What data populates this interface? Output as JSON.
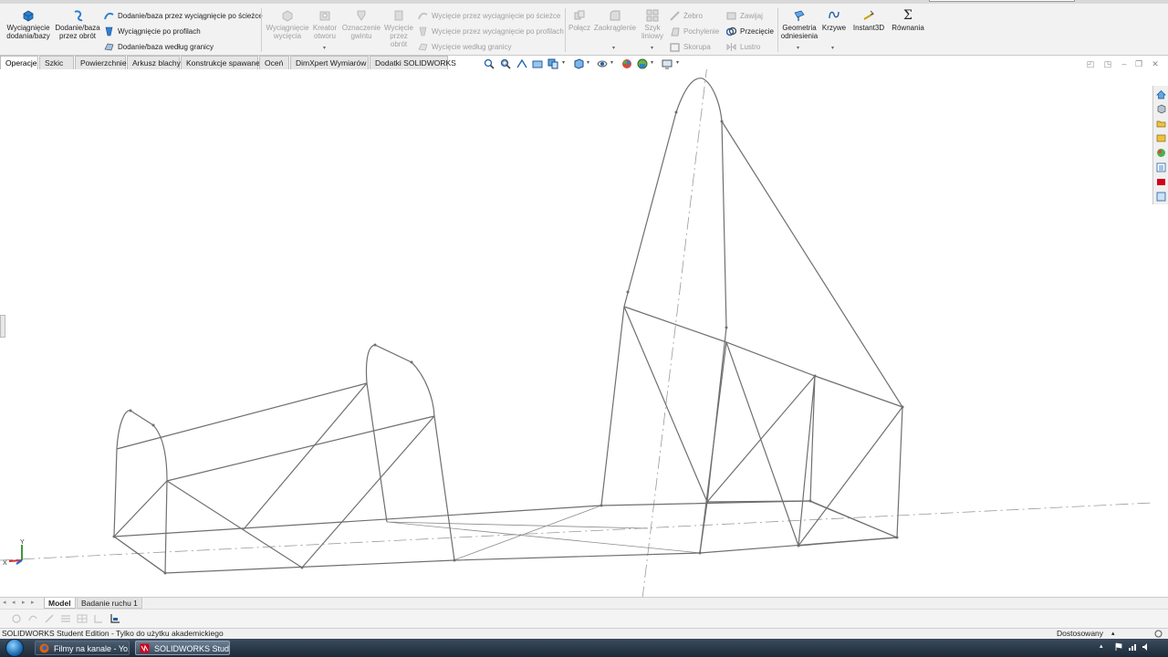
{
  "toolbar_groups": {
    "features_big": [
      {
        "label_line1": "Wyciągnięcie",
        "label_line2": "dodania/bazy",
        "icon": "extrude-boss-icon",
        "enabled": true
      },
      {
        "label_line1": "Dodanie/baza",
        "label_line2": "przez obrót",
        "icon": "revolve-boss-icon",
        "enabled": true
      }
    ],
    "features_small": [
      {
        "label": "Dodanie/baza przez wyciągnięcie po ścieżce",
        "icon": "swept-boss-icon",
        "enabled": true
      },
      {
        "label": "Wyciągnięcie po profilach",
        "icon": "lofted-boss-icon",
        "enabled": true
      },
      {
        "label": "Dodanie/baza według granicy",
        "icon": "boundary-boss-icon",
        "enabled": true
      }
    ],
    "cut_big": [
      {
        "label_line1": "Wyciągnięcie",
        "label_line2": "wycięcia",
        "label_line3": "",
        "icon": "extruded-cut-icon",
        "enabled": false
      },
      {
        "label_line1": "Kreator",
        "label_line2": "otworu",
        "label_line3": "",
        "icon": "hole-wizard-icon",
        "enabled": false
      },
      {
        "label_line1": "Oznaczenie",
        "label_line2": "gwintu",
        "label_line3": "",
        "icon": "thread-icon",
        "enabled": false
      },
      {
        "label_line1": "Wycięcie",
        "label_line2": "przez",
        "label_line3": "obrót",
        "icon": "revolved-cut-icon",
        "enabled": false
      }
    ],
    "cut_small": [
      {
        "label": "Wycięcie przez wyciągnięcie po ścieżce",
        "icon": "swept-cut-icon",
        "enabled": false
      },
      {
        "label": "Wycięcie przez wyciągnięcie po profilach",
        "icon": "lofted-cut-icon",
        "enabled": false
      },
      {
        "label": "Wycięcie według granicy",
        "icon": "boundary-cut-icon",
        "enabled": false
      }
    ],
    "modify_big": [
      {
        "label_line1": "Połącz",
        "label_line2": "",
        "icon": "combine-icon",
        "enabled": false
      },
      {
        "label_line1": "Zaokrąglenie",
        "label_line2": "",
        "icon": "fillet-icon",
        "enabled": false
      },
      {
        "label_line1": "Szyk",
        "label_line2": "liniowy",
        "icon": "linear-pattern-icon",
        "enabled": false
      }
    ],
    "modify_small_col1": [
      {
        "label": "Żebro",
        "icon": "rib-icon",
        "enabled": false
      },
      {
        "label": "Pochylenie",
        "icon": "draft-icon",
        "enabled": false
      },
      {
        "label": "Skorupa",
        "icon": "shell-icon",
        "enabled": false
      }
    ],
    "modify_small_col2": [
      {
        "label": "Zawijaj",
        "icon": "wrap-icon",
        "enabled": false
      },
      {
        "label": "Przecięcie",
        "icon": "intersect-icon",
        "enabled": true
      },
      {
        "label": "Lustro",
        "icon": "mirror-icon",
        "enabled": false
      }
    ],
    "ref_big": [
      {
        "label_line1": "Geometria",
        "label_line2": "odniesienia",
        "icon": "reference-geometry-icon",
        "enabled": true
      },
      {
        "label_line1": "Krzywe",
        "label_line2": "",
        "icon": "curves-icon",
        "enabled": true
      },
      {
        "label_line1": "Instant3D",
        "label_line2": "",
        "icon": "instant3d-icon",
        "enabled": true
      },
      {
        "label_line1": "Równania",
        "label_line2": "",
        "icon": "equations-icon",
        "enabled": true
      }
    ],
    "equation_symbol": "Σ"
  },
  "tabs": [
    {
      "label": "Operacje",
      "active": true
    },
    {
      "label": "Szkic",
      "active": false
    },
    {
      "label": "Powierzchnie",
      "active": false
    },
    {
      "label": "Arkusz blachy",
      "active": false
    },
    {
      "label": "Konstrukcje spawane",
      "active": false
    },
    {
      "label": "Oceń",
      "active": false
    },
    {
      "label": "DimXpert Wymiarów",
      "active": false
    },
    {
      "label": "Dodatki SOLIDWORKS",
      "active": false
    }
  ],
  "bottom_tabs": [
    {
      "label": "Model",
      "active": true
    },
    {
      "label": "Badanie ruchu 1",
      "active": false
    }
  ],
  "status": {
    "left_text": "SOLIDWORKS Student Edition - Tylko do użytku akademickiego",
    "units_text": "Dostosowany"
  },
  "triad": {
    "x_label": "X",
    "y_label": "Y"
  },
  "taskbar": {
    "items": [
      {
        "label": "Filmy na kanale - Yo...",
        "icon": "firefox-icon",
        "active": false
      },
      {
        "label": "SOLIDWORKS Stude...",
        "icon": "solidworks-icon",
        "active": true
      }
    ]
  },
  "colors": {
    "accent_blue": "#1f5fa8",
    "brand_red": "#d0021b",
    "wireframe": "#6f6f6f",
    "disabled_text": "#a0a0a0"
  }
}
